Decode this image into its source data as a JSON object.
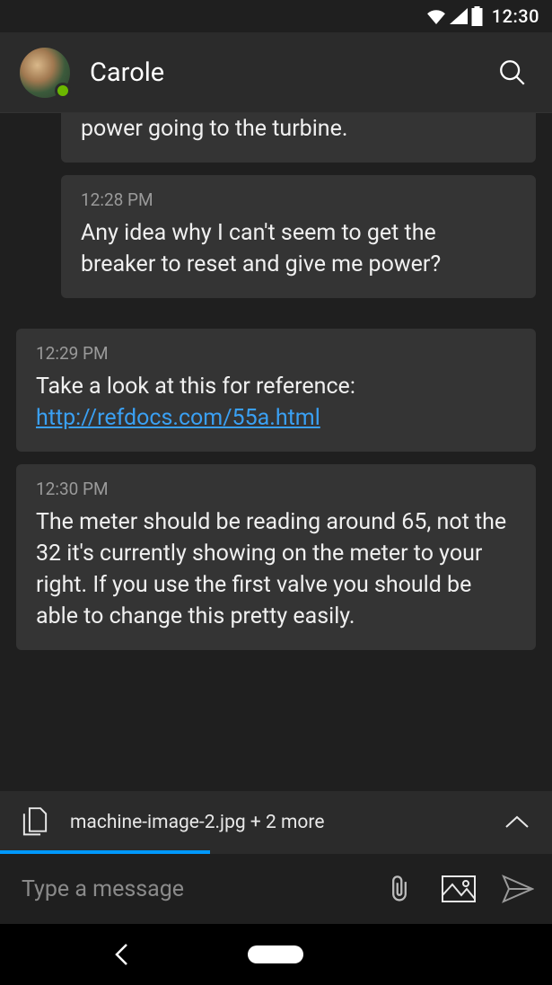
{
  "status": {
    "time": "12:30"
  },
  "header": {
    "name": "Carole",
    "presence": "available"
  },
  "messages": [
    {
      "id": 0,
      "direction": "inbound",
      "cutoffTop": true,
      "timestamp": "",
      "body": "power going to the turbine.",
      "link": null
    },
    {
      "id": 1,
      "direction": "inbound",
      "cutoffTop": false,
      "timestamp": "12:28 PM",
      "body": "Any idea why I can't seem to get the breaker to reset and give me power?",
      "link": null
    },
    {
      "id": 2,
      "direction": "outbound",
      "cutoffTop": false,
      "timestamp": "12:29 PM",
      "body": "Take a look at this for reference: ",
      "link": "http://refdocs.com/55a.html"
    },
    {
      "id": 3,
      "direction": "outbound",
      "cutoffTop": false,
      "timestamp": "12:30 PM",
      "body": "The meter should be reading around 65, not the 32 it's currently showing on the meter to your right. If you use the first valve you should be able to change this pretty easily.",
      "link": null
    }
  ],
  "attachments": {
    "label": "machine-image-2.jpg + 2 more",
    "progressPercent": 38
  },
  "compose": {
    "placeholder": "Type a message"
  },
  "colors": {
    "accent": "#0099ff",
    "link": "#3aa0f3",
    "presence": "#6bb700"
  }
}
